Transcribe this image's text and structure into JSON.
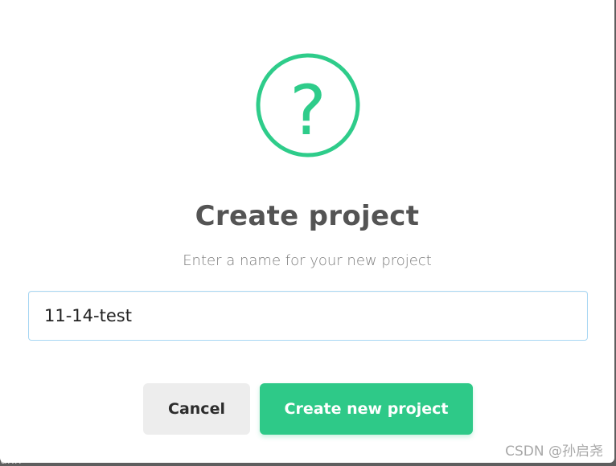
{
  "dialog": {
    "icon": "question-mark-circle-icon",
    "icon_glyph": "?",
    "title": "Create project",
    "subtitle": "Enter a name for your new project",
    "input_value": "11-14-test",
    "cancel_label": "Cancel",
    "confirm_label": "Create new project"
  },
  "watermark": "CSDN @孙启尧",
  "backdrop_text": "unn",
  "colors": {
    "accent": "#2ec988",
    "icon_stroke": "#2ecc8a",
    "input_border": "#a8d7f3",
    "cancel_bg": "#ededed",
    "title_text": "#545454",
    "subtitle_text": "#7d7d7d",
    "backdrop": "#5e5e5e"
  }
}
